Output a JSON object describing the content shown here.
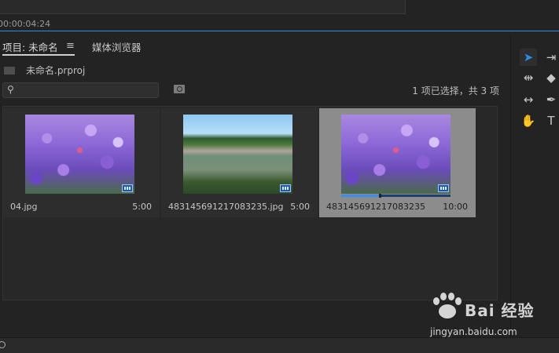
{
  "timeline": {
    "timecode": "00:00:04:24"
  },
  "tabs": {
    "project_label": "项目: 未命名",
    "menu_glyph": "≡",
    "media_browser_label": "媒体浏览器"
  },
  "project": {
    "file_name": "未命名.prproj",
    "search_placeholder": "",
    "selection_info": "1 项已选择，共 3 项"
  },
  "items": [
    {
      "name": "04.jpg",
      "duration": "5:00",
      "thumb": "flowers",
      "selected": false
    },
    {
      "name": "483145691217083235.jpg",
      "duration": "5:00",
      "thumb": "lake",
      "selected": false
    },
    {
      "name": "483145691217083235",
      "duration": "10:00",
      "thumb": "flowers",
      "selected": true,
      "progress": 0.35
    }
  ],
  "icons": {
    "search": "search-icon",
    "new_bin": "new-bin-icon",
    "lock": "lock-icon",
    "list_view": "list-view-icon",
    "icon_view": "icon-view-icon",
    "sort": "sort-icon",
    "find": "find-icon",
    "new_item": "new-item-icon",
    "delete": "delete-icon"
  },
  "tools": [
    {
      "name": "selection-tool",
      "glyph": "➤",
      "active": true
    },
    {
      "name": "track-select-tool",
      "glyph": "⇥",
      "active": false
    },
    {
      "name": "ripple-edit-tool",
      "glyph": "⇹",
      "active": false
    },
    {
      "name": "razor-tool",
      "glyph": "◆",
      "active": false
    },
    {
      "name": "slip-tool",
      "glyph": "↔",
      "active": false
    },
    {
      "name": "pen-tool",
      "glyph": "✒",
      "active": false
    },
    {
      "name": "hand-tool",
      "glyph": "✋",
      "active": false
    },
    {
      "name": "type-tool",
      "glyph": "T",
      "active": false
    }
  ],
  "watermark": {
    "brand": "Bai 经验",
    "url": "jingyan.baidu.com"
  },
  "colors": {
    "accent": "#2d8ceb",
    "selected_tile": "#8c8c8c",
    "panel_bg": "#232323"
  }
}
